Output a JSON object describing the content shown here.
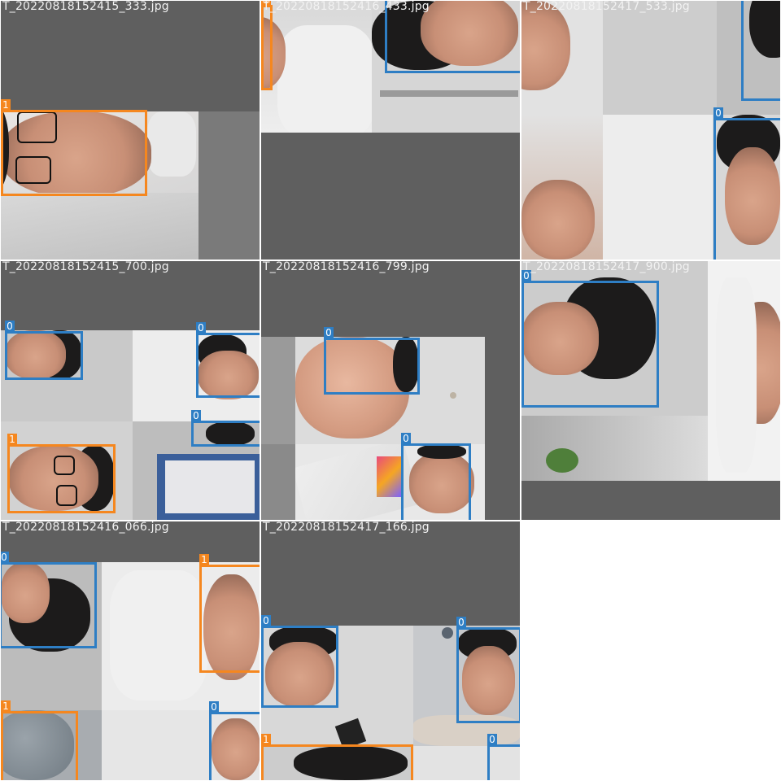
{
  "tiles": [
    {
      "filename": "T_20220818152415_333.jpg",
      "labels": [
        "1"
      ]
    },
    {
      "filename": "T_20220818152416_433.jpg",
      "labels": [
        "1"
      ]
    },
    {
      "filename": "T_20220818152417_533.jpg",
      "labels": [
        "0"
      ]
    },
    {
      "filename": "T_20220818152415_700.jpg",
      "labels": [
        "0",
        "0",
        "1",
        "0"
      ]
    },
    {
      "filename": "T_20220818152416_799.jpg",
      "labels": [
        "0",
        "0"
      ]
    },
    {
      "filename": "T_20220818152417_900.jpg",
      "labels": [
        "0"
      ]
    },
    {
      "filename": "T_20220818152416_066.jpg",
      "labels": [
        "0",
        "1",
        "1",
        "0"
      ]
    },
    {
      "filename": "T_20220818152417_166.jpg",
      "labels": [
        "0",
        "0",
        "1",
        "0"
      ]
    }
  ],
  "colors": {
    "class_0_box": "#2e7ec4",
    "class_1_box": "#f5871f",
    "padding_gray": "#5f5f5f",
    "title_text": "#f2f2f2"
  }
}
